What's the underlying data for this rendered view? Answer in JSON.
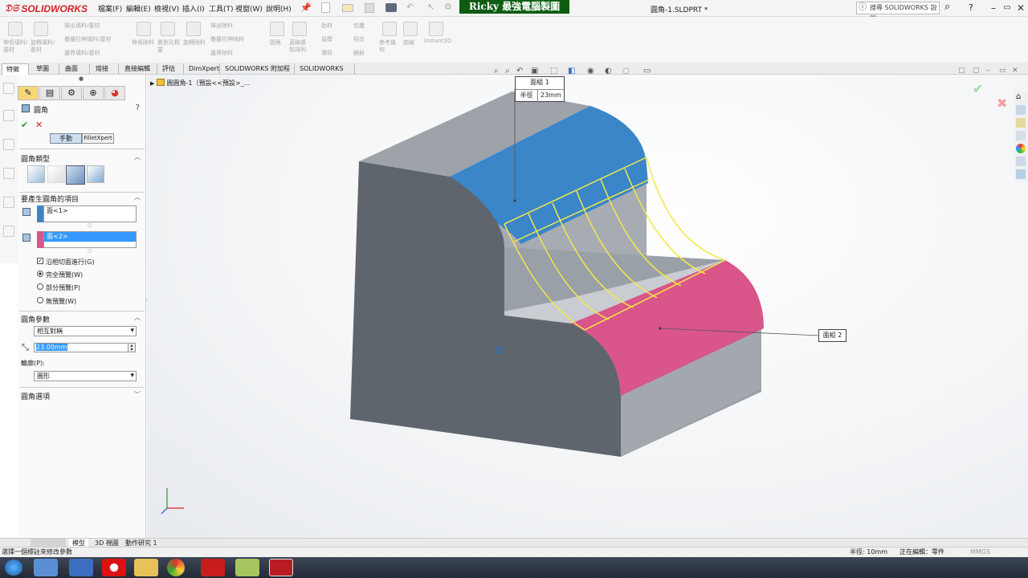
{
  "app": {
    "brand": "SOLIDWORKS",
    "doc_title": "圓角-1.SLDPRT *"
  },
  "menu": [
    "檔案(F)",
    "編輯(E)",
    "檢視(V)",
    "插入(I)",
    "工具(T)",
    "視窗(W)",
    "說明(H)"
  ],
  "banner": "Ricky 最強電腦製圖",
  "search": {
    "placeholder": "搜尋 SOLIDWORKS 說明"
  },
  "command_labels": {
    "boss_extrude": "伸長填料/基材",
    "revolve": "旋轉填料/基材",
    "sweep": "掃出填料/基材",
    "loft": "疊層拉伸填料/基材",
    "boundary": "邊界填料/基材",
    "cut_extrude": "伸長除料",
    "hole_wizard": "異型孔精靈",
    "cut_revolve": "旋轉除料",
    "sweep_cut": "掃出除料",
    "loft_cut": "疊層拉伸除料",
    "boundary_cut": "邊界除料",
    "fillet": "圓角",
    "linear_pattern": "直線複製排列",
    "rib": "肋材",
    "draft": "拔模",
    "shell": "薄殼",
    "wrap": "包覆",
    "intersect": "相交",
    "mirror": "鏡射",
    "ref_geometry": "參考幾何",
    "curves": "曲線",
    "instant3d": "Instant3D"
  },
  "tabs": [
    "特徵",
    "草圖",
    "曲面",
    "熔接",
    "直接編輯",
    "評估",
    "DimXpert",
    "SOLIDWORKS 附加程式",
    "SOLIDWORKS MBD"
  ],
  "property_manager": {
    "title": "圓角",
    "mode_manual": "手動",
    "mode_filletxpert": "FilletXpert",
    "fillet_type_header": "圓角類型",
    "items_header": "要產生圓角的項目",
    "face1": "面<1>",
    "face2": "面<2>",
    "tangent_propagation": "沿相切面進行(G)",
    "full_preview": "完全預覽(W)",
    "partial_preview": "部分預覽(P)",
    "no_preview": "無預覽(W)",
    "params_header": "圓角參數",
    "param_method": "相互對稱",
    "radius_value": "23.00mm",
    "profile_label": "輪廓(P):",
    "profile_value": "圓形",
    "options_header": "圓角選項"
  },
  "viewport": {
    "feature_tree_item": "圓圓角-1（預設<<預設>_...",
    "callout1_title": "面組 1",
    "callout1_key": "半徑",
    "callout1_value": "23mm",
    "callout2_title": "面組 2"
  },
  "bottom_tabs": [
    "模型",
    "3D 視圖",
    "動作研究 1"
  ],
  "status": {
    "left": "選擇一個標註來修改參數",
    "radius": "半徑: 10mm",
    "editing": "正在編輯：零件",
    "units": "MMGS"
  },
  "colors": {
    "face1": "#3a86c8",
    "face2": "#d9558a",
    "body": "#6f7479",
    "preview": "#f3e84a",
    "banner": "#0d5c12"
  }
}
